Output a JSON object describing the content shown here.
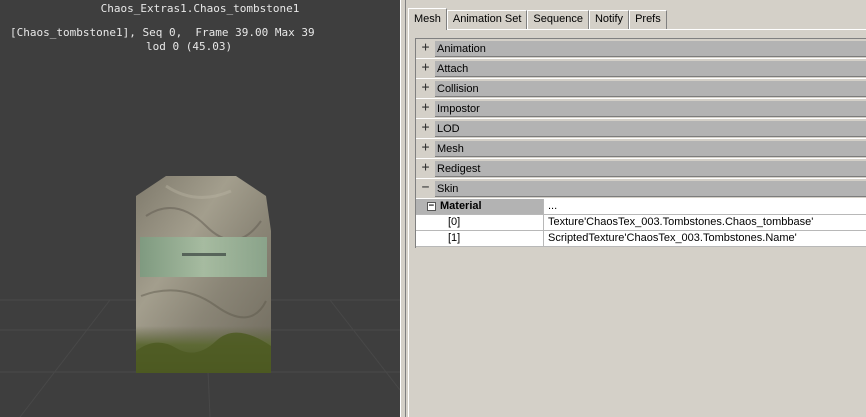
{
  "viewport": {
    "title": "Chaos_Extras1.Chaos_tombstone1",
    "info_line1": "[Chaos_tombstone1], Seq 0,  Frame 39.00 Max 39",
    "info_line2": "lod 0 (45.03)",
    "background": "#3e3e3e",
    "text_color": "#e8e8e8"
  },
  "tabs": [
    {
      "label": "Mesh",
      "active": true
    },
    {
      "label": "Animation Set",
      "active": false
    },
    {
      "label": "Sequence",
      "active": false
    },
    {
      "label": "Notify",
      "active": false
    },
    {
      "label": "Prefs",
      "active": false
    }
  ],
  "properties": {
    "categories": [
      {
        "label": "Animation",
        "expander": "+"
      },
      {
        "label": "Attach",
        "expander": "+"
      },
      {
        "label": "Collision",
        "expander": "+"
      },
      {
        "label": "Impostor",
        "expander": "+"
      },
      {
        "label": "LOD",
        "expander": "+"
      },
      {
        "label": "Mesh",
        "expander": "+"
      },
      {
        "label": "Redigest",
        "expander": "+"
      },
      {
        "label": "Skin",
        "expander": "−"
      }
    ],
    "material": {
      "label": "Material",
      "expander": "−",
      "value": "...",
      "items": [
        {
          "index": "[0]",
          "value": "Texture'ChaosTex_003.Tombstones.Chaos_tombbase'"
        },
        {
          "index": "[1]",
          "value": "ScriptedTexture'ChaosTex_003.Tombstones.Name'"
        }
      ]
    }
  },
  "colors": {
    "panel_bg": "#d4d0c8",
    "category_bar": "#b3b3b3"
  }
}
